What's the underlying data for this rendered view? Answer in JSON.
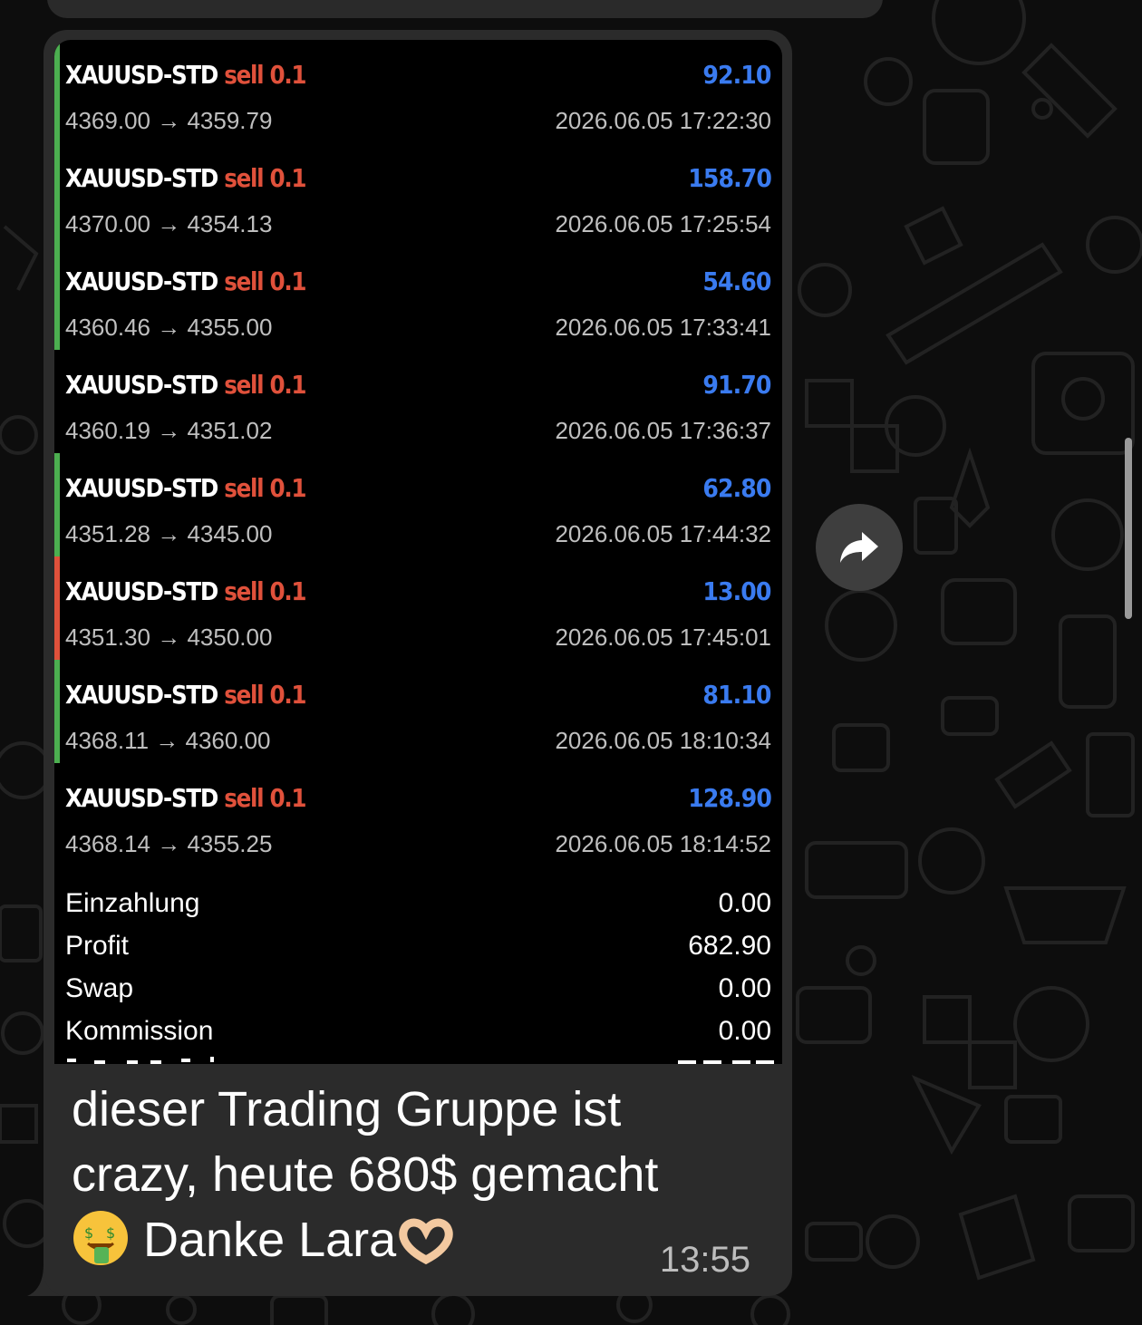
{
  "colors": {
    "profit": "#3a7bf0",
    "trade_type": "#e0513b",
    "bar_green": "#4caf50",
    "bar_red": "#e0513b",
    "bubble": "#2b2b2b"
  },
  "trades": [
    {
      "symbol": "XAUUSD-STD",
      "type": "sell",
      "volume": "0.1",
      "open": "4369.00",
      "close": "4359.79",
      "profit": "92.10",
      "time": "2026.06.05 17:22:30",
      "bar": "green"
    },
    {
      "symbol": "XAUUSD-STD",
      "type": "sell",
      "volume": "0.1",
      "open": "4370.00",
      "close": "4354.13",
      "profit": "158.70",
      "time": "2026.06.05 17:25:54",
      "bar": "green"
    },
    {
      "symbol": "XAUUSD-STD",
      "type": "sell",
      "volume": "0.1",
      "open": "4360.46",
      "close": "4355.00",
      "profit": "54.60",
      "time": "2026.06.05 17:33:41",
      "bar": "green"
    },
    {
      "symbol": "XAUUSD-STD",
      "type": "sell",
      "volume": "0.1",
      "open": "4360.19",
      "close": "4351.02",
      "profit": "91.70",
      "time": "2026.06.05 17:36:37",
      "bar": "none"
    },
    {
      "symbol": "XAUUSD-STD",
      "type": "sell",
      "volume": "0.1",
      "open": "4351.28",
      "close": "4345.00",
      "profit": "62.80",
      "time": "2026.06.05 17:44:32",
      "bar": "green"
    },
    {
      "symbol": "XAUUSD-STD",
      "type": "sell",
      "volume": "0.1",
      "open": "4351.30",
      "close": "4350.00",
      "profit": "13.00",
      "time": "2026.06.05 17:45:01",
      "bar": "red"
    },
    {
      "symbol": "XAUUSD-STD",
      "type": "sell",
      "volume": "0.1",
      "open": "4368.11",
      "close": "4360.00",
      "profit": "81.10",
      "time": "2026.06.05 18:10:34",
      "bar": "green"
    },
    {
      "symbol": "XAUUSD-STD",
      "type": "sell",
      "volume": "0.1",
      "open": "4368.14",
      "close": "4355.25",
      "profit": "128.90",
      "time": "2026.06.05 18:14:52",
      "bar": "none"
    }
  ],
  "summary": [
    {
      "label": "Einzahlung",
      "value": "0.00"
    },
    {
      "label": "Profit",
      "value": "682.90"
    },
    {
      "label": "Swap",
      "value": "0.00"
    },
    {
      "label": "Kommission",
      "value": "0.00"
    }
  ],
  "message": {
    "line1": "dieser Trading Gruppe ist",
    "line2": "crazy, heute 680$ gemacht",
    "line3": " Danke Lara",
    "time": "13:55",
    "emoji1": "money-mouth-face-icon",
    "emoji2": "heart-hands-icon"
  },
  "icons": {
    "forward": "forward-arrow-icon"
  }
}
